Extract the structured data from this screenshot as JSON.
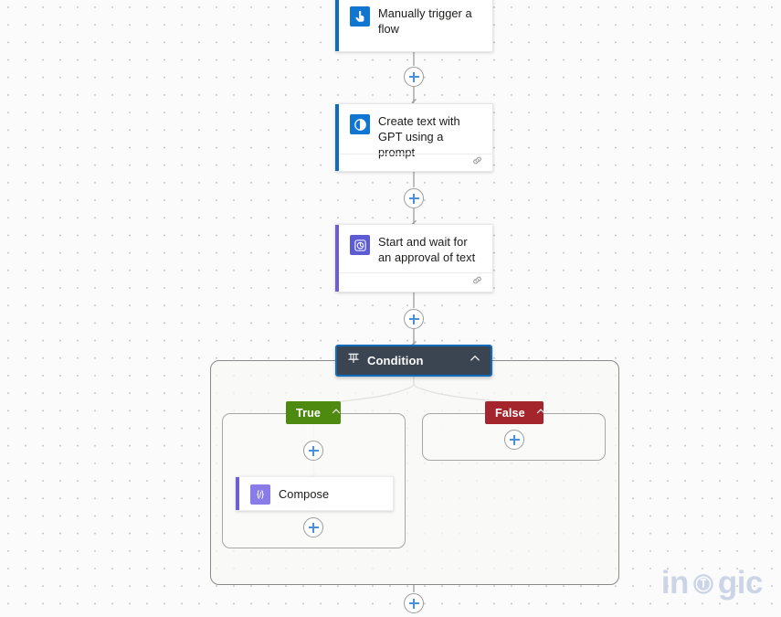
{
  "canvas": {
    "background_color": "#fbfbfb",
    "dot_color": "#9a9a9a"
  },
  "watermark": {
    "text_before": "in",
    "text_after": "gic",
    "full_text": "inogic",
    "color": "#ccd5e8"
  },
  "flow": {
    "nodes": [
      {
        "id": "trigger",
        "title": "Manually trigger a flow",
        "icon": "manual-trigger-icon",
        "accent_color": "#0f6cbd",
        "icon_bg": "#1176d1",
        "has_footer": false
      },
      {
        "id": "gpt",
        "title": "Create text with GPT using a prompt",
        "icon": "ai-builder-gpt-icon",
        "accent_color": "#0f6cbd",
        "icon_bg": "#1176d1",
        "has_footer": true,
        "footer_icon": "link-chain-icon"
      },
      {
        "id": "approval",
        "title": "Start and wait for an approval of text",
        "icon": "approval-clock-icon",
        "accent_color": "#6c5fd4",
        "icon_bg": "#5c5bd4",
        "has_footer": true,
        "footer_icon": "link-chain-icon"
      }
    ],
    "condition": {
      "label": "Condition",
      "icon": "condition-branch-icon",
      "chevron": "chevron-up-icon",
      "background_color": "#3b4552",
      "selection_color": "#0f6cbd",
      "selected": true
    },
    "branches": [
      {
        "id": "true",
        "label": "True",
        "color": "#4f8a10",
        "chevron": "chevron-up-icon",
        "actions": [
          {
            "id": "compose",
            "title": "Compose",
            "icon": "compose-braces-icon",
            "accent_color": "#6c5fd4",
            "icon_bg": "#8a7ce8"
          }
        ]
      },
      {
        "id": "false",
        "label": "False",
        "color": "#a4262c",
        "chevron": "chevron-up-icon",
        "actions": []
      }
    ],
    "add_buttons": [
      {
        "id": "add-after-trigger",
        "name": "add-step-after-trigger"
      },
      {
        "id": "add-after-gpt",
        "name": "add-step-after-gpt"
      },
      {
        "id": "add-after-approval",
        "name": "add-step-after-approval"
      },
      {
        "id": "add-in-true-before",
        "name": "add-step-true-branch-top"
      },
      {
        "id": "add-in-true-after",
        "name": "add-step-true-branch-bottom"
      },
      {
        "id": "add-in-false",
        "name": "add-step-false-branch"
      },
      {
        "id": "add-after-condition",
        "name": "add-step-after-condition"
      }
    ]
  }
}
